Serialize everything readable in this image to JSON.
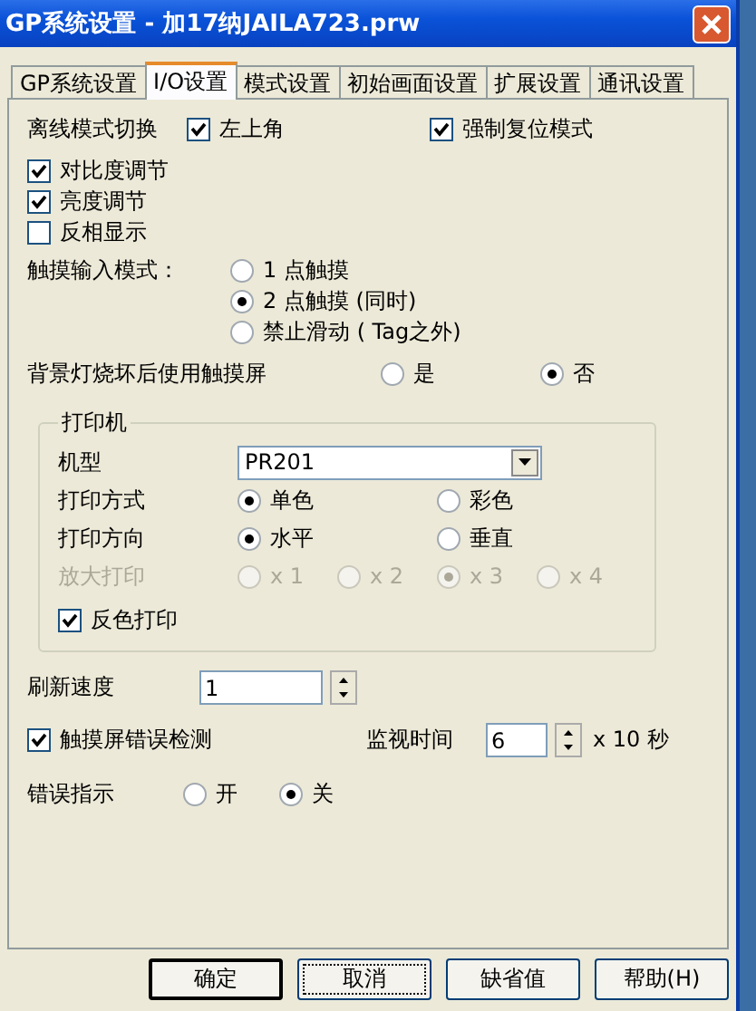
{
  "window": {
    "title": "GP系统设置 - 加17纳JAILA723.prw"
  },
  "tabs": [
    {
      "label": "GP系统设置",
      "selected": false
    },
    {
      "label": "I/O设置",
      "selected": true
    },
    {
      "label": "模式设置",
      "selected": false
    },
    {
      "label": "初始画面设置",
      "selected": false
    },
    {
      "label": "扩展设置",
      "selected": false
    },
    {
      "label": "通讯设置",
      "selected": false
    }
  ],
  "offline_mode": {
    "label": "离线模式切换",
    "options": [
      {
        "label": "左上角",
        "checked": true
      },
      {
        "label": "强制复位模式",
        "checked": true
      }
    ]
  },
  "display_checks": [
    {
      "label": "对比度调节",
      "checked": true
    },
    {
      "label": "亮度调节",
      "checked": true
    },
    {
      "label": "反相显示",
      "checked": false
    }
  ],
  "touch_mode": {
    "label": "触摸输入模式：",
    "options": [
      {
        "label": "1 点触摸",
        "selected": false
      },
      {
        "label": "2 点触摸 (同时)",
        "selected": true
      },
      {
        "label": "禁止滑动 ( Tag之外)",
        "selected": false
      }
    ]
  },
  "backlight": {
    "label": "背景灯烧坏后使用触摸屏",
    "options": [
      {
        "label": "是",
        "selected": false
      },
      {
        "label": "否",
        "selected": true
      }
    ]
  },
  "printer": {
    "title": "打印机",
    "model_label": "机型",
    "model": "PR201",
    "rows": [
      {
        "label": "打印方式",
        "disabled": false,
        "options": [
          {
            "label": "单色",
            "selected": true
          },
          {
            "label": "彩色",
            "selected": false
          }
        ]
      },
      {
        "label": "打印方向",
        "disabled": false,
        "options": [
          {
            "label": "水平",
            "selected": true
          },
          {
            "label": "垂直",
            "selected": false
          }
        ]
      },
      {
        "label": "放大打印",
        "disabled": true,
        "options": [
          {
            "label": "x 1",
            "selected": false
          },
          {
            "label": "x 2",
            "selected": false
          },
          {
            "label": "x 3",
            "selected": true
          },
          {
            "label": "x 4",
            "selected": false
          }
        ]
      }
    ],
    "reverse": {
      "label": "反色打印",
      "checked": true
    }
  },
  "refresh": {
    "label": "刷新速度",
    "value": "1"
  },
  "touch_error": {
    "label": "触摸屏错误检测",
    "checked": true,
    "monitor_label": "监视时间",
    "value": "6",
    "unit": "x 10 秒"
  },
  "error_indicator": {
    "label": "错误指示",
    "options": [
      {
        "label": "开",
        "selected": false
      },
      {
        "label": "关",
        "selected": true
      }
    ]
  },
  "buttons": [
    {
      "label": "确定",
      "kind": "default"
    },
    {
      "label": "取消",
      "kind": "focused"
    },
    {
      "label": "缺省值",
      "kind": "normal"
    },
    {
      "label": "帮助(H)",
      "kind": "normal"
    }
  ]
}
